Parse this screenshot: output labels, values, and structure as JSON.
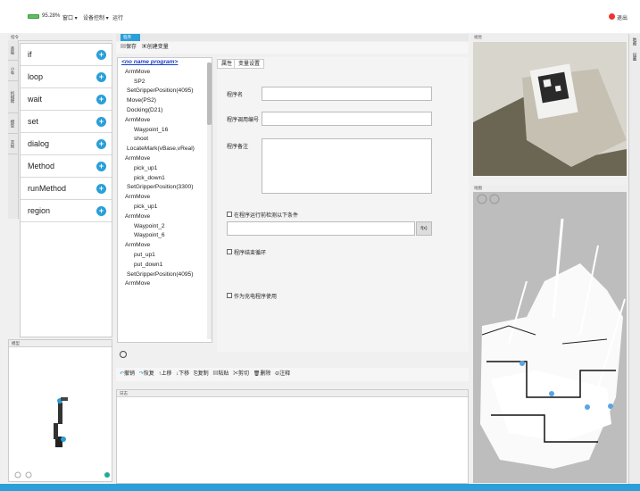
{
  "topbar": {
    "battery": "95.28%",
    "window_menu": "窗口 ▾",
    "device_menu": "设备控制 ▾",
    "run": "运行",
    "exit": "退出"
  },
  "left_panel": {
    "title": "指令",
    "side_tabs": [
      "基础",
      "小车",
      "机械臂",
      "模型",
      "其他"
    ],
    "commands": [
      "if",
      "loop",
      "wait",
      "set",
      "dialog",
      "Method",
      "runMethod",
      "region"
    ]
  },
  "robot_panel": {
    "title": "模型"
  },
  "program": {
    "tab": "程序",
    "save": "保存",
    "create_var": "创建变量",
    "tree": [
      "<no name program>",
      "ArmMove",
      "SP2",
      "SetGripperPosition(4095)",
      "Move(PS2)",
      "Docking(D21)",
      "ArmMove",
      "Waypoint_16",
      "shoot",
      "LocateMark(vBase,vReal)",
      "ArmMove",
      "pick_up1",
      "pick_down1",
      "SetGripperPosition(3300)",
      "ArmMove",
      "pick_up1",
      "ArmMove",
      "Waypoint_2",
      "Waypoint_6",
      "ArmMove",
      "put_up1",
      "put_down1",
      "SetGripperPosition(4095)",
      "ArmMove"
    ]
  },
  "props": {
    "tab_attr": "属性",
    "tab_var": "变量设置",
    "name_label": "程序名",
    "id_label": "程序调用编号",
    "note_label": "程序备注",
    "cond_label": "在程序运行前检测以下条件",
    "fx": "f(x)",
    "loop_label": "程序结束循环",
    "charge_label": "作为充电程序使用"
  },
  "actions": {
    "undo": "撤销",
    "redo": "恢复",
    "up": "上移",
    "down": "下移",
    "copy": "复制",
    "paste": "粘贴",
    "cut": "剪切",
    "delete": "删除",
    "comment": "注释"
  },
  "log": {
    "title": "日志"
  },
  "camera": {
    "title": "视觉"
  },
  "map": {
    "title": "地图"
  },
  "right_strip": [
    "地图",
    "设置"
  ],
  "colors": {
    "accent": "#2a9fd8",
    "exit": "#e33333"
  }
}
